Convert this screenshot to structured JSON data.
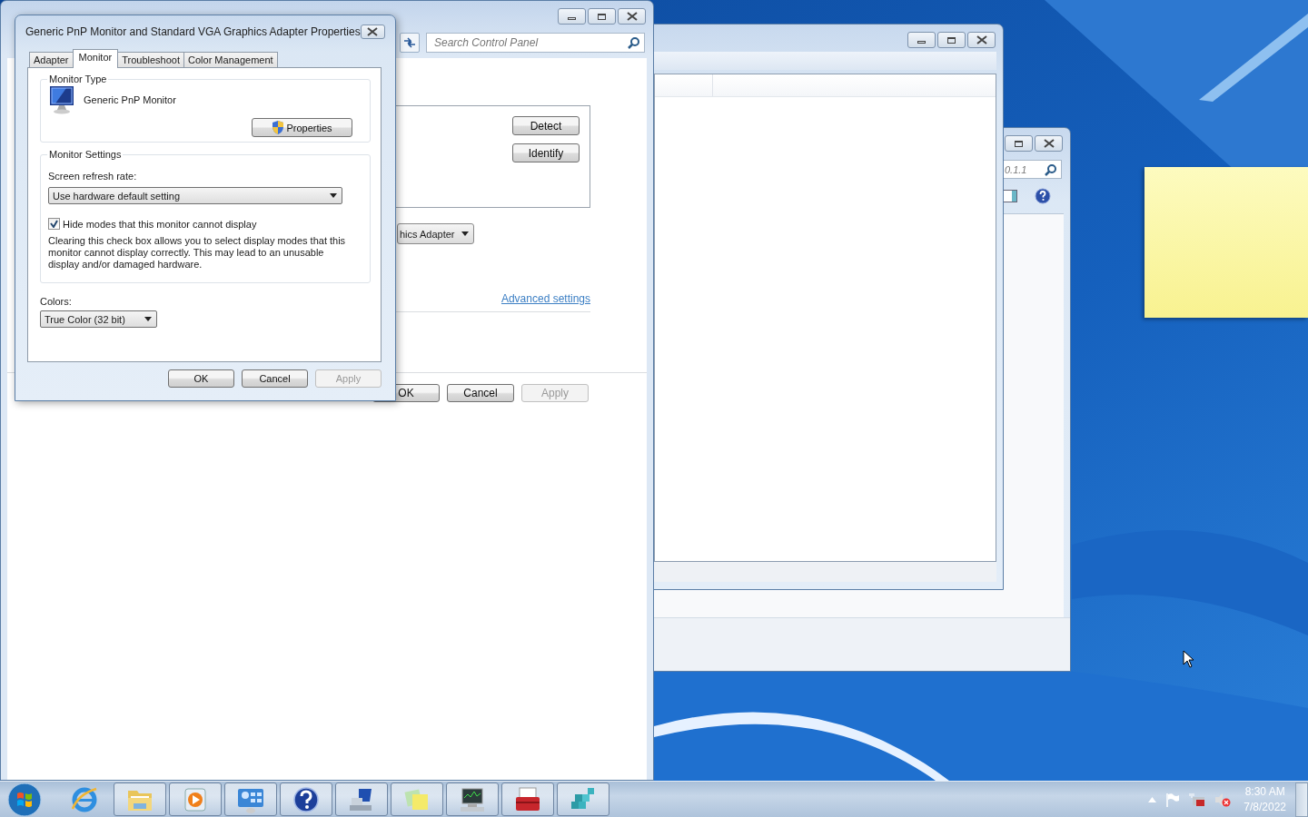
{
  "dialog": {
    "title": "Generic PnP Monitor and Standard VGA Graphics Adapter Properties",
    "tabs": [
      {
        "label": "Adapter",
        "selected": false
      },
      {
        "label": "Monitor",
        "selected": true
      },
      {
        "label": "Troubleshoot",
        "selected": false
      },
      {
        "label": "Color Management",
        "selected": false
      }
    ],
    "monitor_type": {
      "heading": "Monitor Type",
      "name": "Generic PnP Monitor",
      "button": "Properties"
    },
    "monitor_settings": {
      "heading": "Monitor Settings",
      "refresh_label": "Screen refresh rate:",
      "refresh_value": "Use hardware default setting",
      "hide_modes": {
        "label": "Hide modes that this monitor cannot display",
        "checked": true
      },
      "note": "Clearing this check box allows you to select display modes that this monitor cannot display correctly. This may lead to an unusable display and/or damaged hardware."
    },
    "colors": {
      "label": "Colors:",
      "value": "True Color (32 bit)"
    },
    "buttons": [
      {
        "label": "OK",
        "disabled": false
      },
      {
        "label": "Cancel",
        "disabled": false
      },
      {
        "label": "Apply",
        "disabled": true
      }
    ]
  },
  "control_panel": {
    "search_placeholder": "Search Control Panel",
    "detect_button": "Detect",
    "identify_button": "Identify",
    "display_value": "hics Adapter",
    "advanced_link": "Advanced settings",
    "buttons": [
      {
        "label": "OK",
        "disabled": false
      },
      {
        "label": "Cancel",
        "disabled": false
      },
      {
        "label": "Apply",
        "disabled": true
      }
    ]
  },
  "back_window": {
    "search_value": "0.1.1"
  },
  "taskbar": {
    "apps": [
      {
        "kind": "ie",
        "running": false
      },
      {
        "kind": "explorer",
        "running": true
      },
      {
        "kind": "media",
        "running": true
      },
      {
        "kind": "control",
        "running": true
      },
      {
        "kind": "help",
        "running": true
      },
      {
        "kind": "display",
        "running": true
      },
      {
        "kind": "notes",
        "running": true
      },
      {
        "kind": "sysmon",
        "running": true
      },
      {
        "kind": "toolbox",
        "running": true
      },
      {
        "kind": "registry",
        "running": true
      }
    ],
    "time": "8:30 AM",
    "date": "7/8/2022"
  }
}
